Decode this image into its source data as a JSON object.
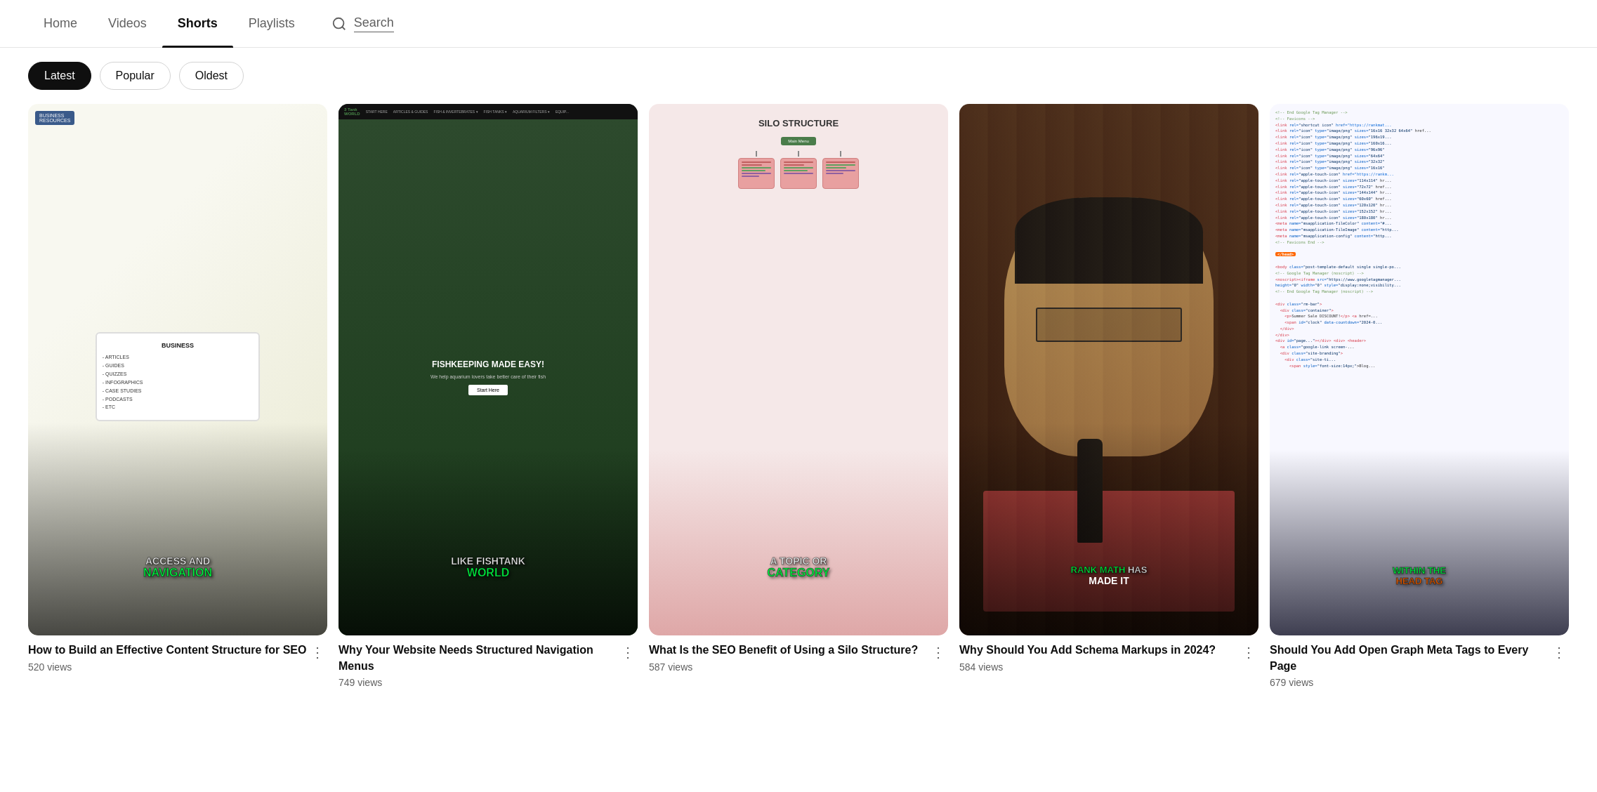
{
  "nav": {
    "items": [
      {
        "id": "home",
        "label": "Home",
        "active": false
      },
      {
        "id": "videos",
        "label": "Videos",
        "active": false
      },
      {
        "id": "shorts",
        "label": "Shorts",
        "active": true
      },
      {
        "id": "playlists",
        "label": "Playlists",
        "active": false
      }
    ],
    "search_label": "Search"
  },
  "filters": {
    "buttons": [
      {
        "id": "latest",
        "label": "Latest",
        "active": true
      },
      {
        "id": "popular",
        "label": "Popular",
        "active": false
      },
      {
        "id": "oldest",
        "label": "Oldest",
        "active": false
      }
    ]
  },
  "shorts": [
    {
      "id": "card-1",
      "title": "How to Build an Effective Content Structure for SEO",
      "views": "520 views",
      "caption1": "ACCESS AND",
      "caption2": "NAVIGATION",
      "thumb_type": "content-structure"
    },
    {
      "id": "card-2",
      "title": "Why Your Website Needs Structured Navigation Menus",
      "views": "749 views",
      "caption1": "LIKE FISHTANK",
      "caption2": "WORLD",
      "thumb_type": "fishtank"
    },
    {
      "id": "card-3",
      "title": "What Is the SEO Benefit of Using a Silo Structure?",
      "views": "587 views",
      "caption1": "A TOPIC OR",
      "caption2": "CATEGORY",
      "thumb_type": "silo"
    },
    {
      "id": "card-4",
      "title": "Why Should You Add Schema Markups in 2024?",
      "views": "584 views",
      "caption1": "RANK MATH HAS",
      "caption2": "MADE IT",
      "thumb_type": "person"
    },
    {
      "id": "card-5",
      "title": "Should You Add Open Graph Meta Tags to Every Page",
      "views": "679 views",
      "caption1": "WITHIN THE",
      "caption2": "HEAD TAG",
      "thumb_type": "code"
    }
  ],
  "icons": {
    "search": "🔍",
    "more": "⋮"
  }
}
